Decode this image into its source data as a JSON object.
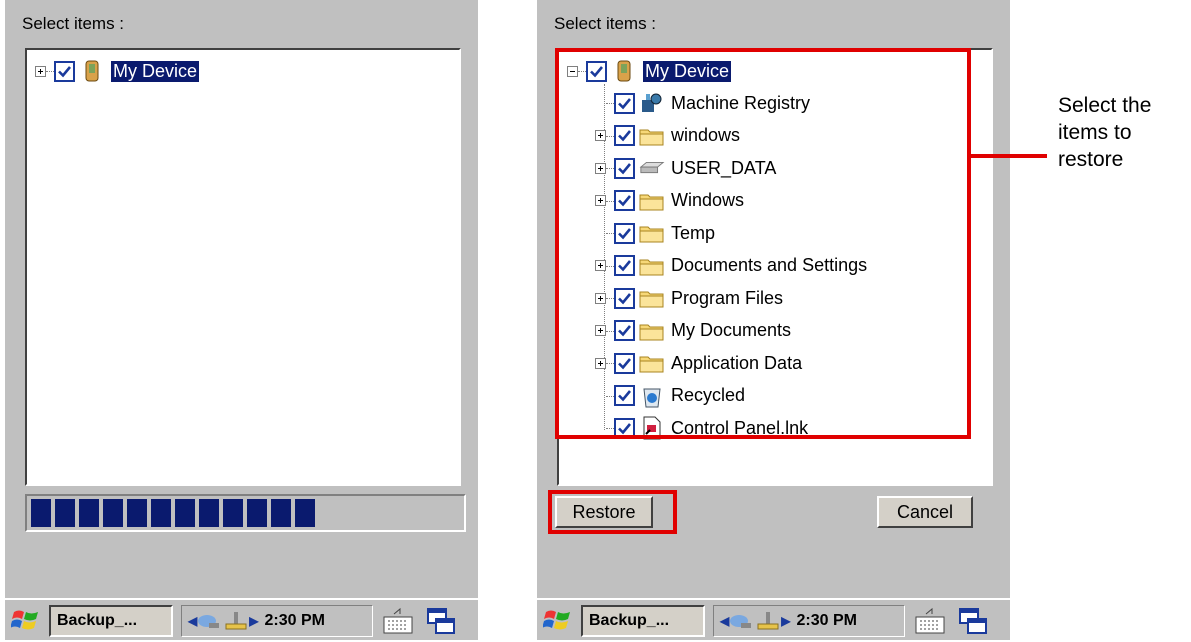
{
  "left": {
    "title": "Select items :",
    "root_label": "My Device",
    "progress_segments": 12,
    "progress_fraction": 0.66
  },
  "right": {
    "title": "Select items :",
    "root_label": "My Device",
    "items": [
      {
        "label": "Machine Registry",
        "icon": "registry-icon",
        "expandable": false
      },
      {
        "label": "windows",
        "icon": "folder-icon",
        "expandable": true
      },
      {
        "label": "USER_DATA",
        "icon": "drive-icon",
        "expandable": true
      },
      {
        "label": "Windows",
        "icon": "folder-icon",
        "expandable": true
      },
      {
        "label": "Temp",
        "icon": "folder-icon",
        "expandable": false
      },
      {
        "label": "Documents and Settings",
        "icon": "folder-icon",
        "expandable": true
      },
      {
        "label": "Program Files",
        "icon": "folder-icon",
        "expandable": true
      },
      {
        "label": "My Documents",
        "icon": "folder-icon",
        "expandable": true
      },
      {
        "label": "Application Data",
        "icon": "folder-icon",
        "expandable": true
      },
      {
        "label": "Recycled",
        "icon": "recycle-bin-icon",
        "expandable": false
      },
      {
        "label": "Control Panel.lnk",
        "icon": "shortcut-icon",
        "expandable": false
      }
    ],
    "restore_button": "Restore",
    "cancel_button": "Cancel"
  },
  "taskbar": {
    "app_label": "Backup_...",
    "time": "2:30 PM"
  },
  "callout": {
    "lines": [
      "Select the",
      "items to",
      "restore"
    ]
  },
  "colors": {
    "highlight": "#0a1a6e",
    "annotation_red": "#e00000",
    "window_gray": "#c0c0c0"
  }
}
